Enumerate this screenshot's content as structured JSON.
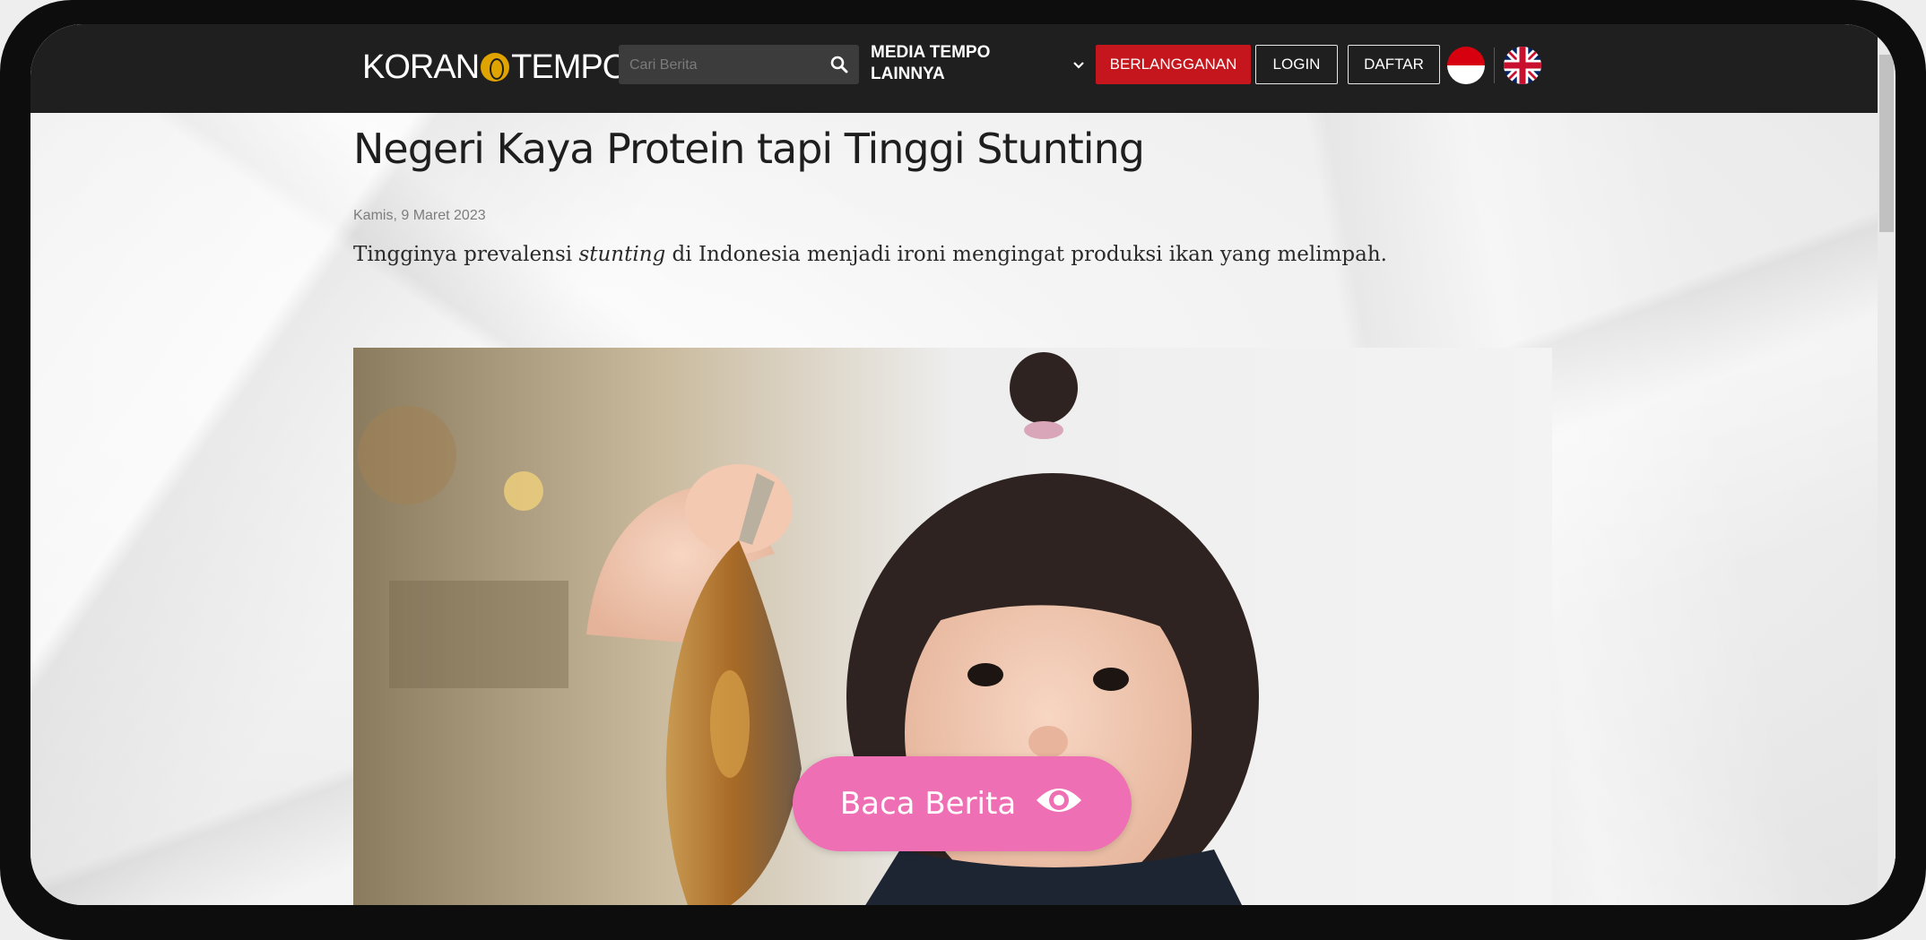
{
  "header": {
    "logo_text": "KORAN TEMPO",
    "search_placeholder": "Cari Berita",
    "media_menu_label": "MEDIA TEMPO LAINNYA",
    "subscribe_label": "BERLANGGANAN",
    "login_label": "LOGIN",
    "register_label": "DAFTAR",
    "icons": [
      "search-icon",
      "chevron-down-icon",
      "flag-indonesia-icon",
      "flag-uk-icon"
    ]
  },
  "article": {
    "title": "Negeri Kaya Protein tapi Tinggi Stunting",
    "date": "Kamis, 9 Maret 2023",
    "lead_before": "Tingginya prevalensi ",
    "lead_italic": "stunting",
    "lead_after": " di Indonesia menjadi ironi mengingat produksi ikan yang melimpah.",
    "cta_label": "Baca Berita"
  },
  "colors": {
    "topbar": "#1f1f1f",
    "subscribe": "#c4161c",
    "cta": "#ef6fb5",
    "logo_accent": "#e0a400"
  }
}
